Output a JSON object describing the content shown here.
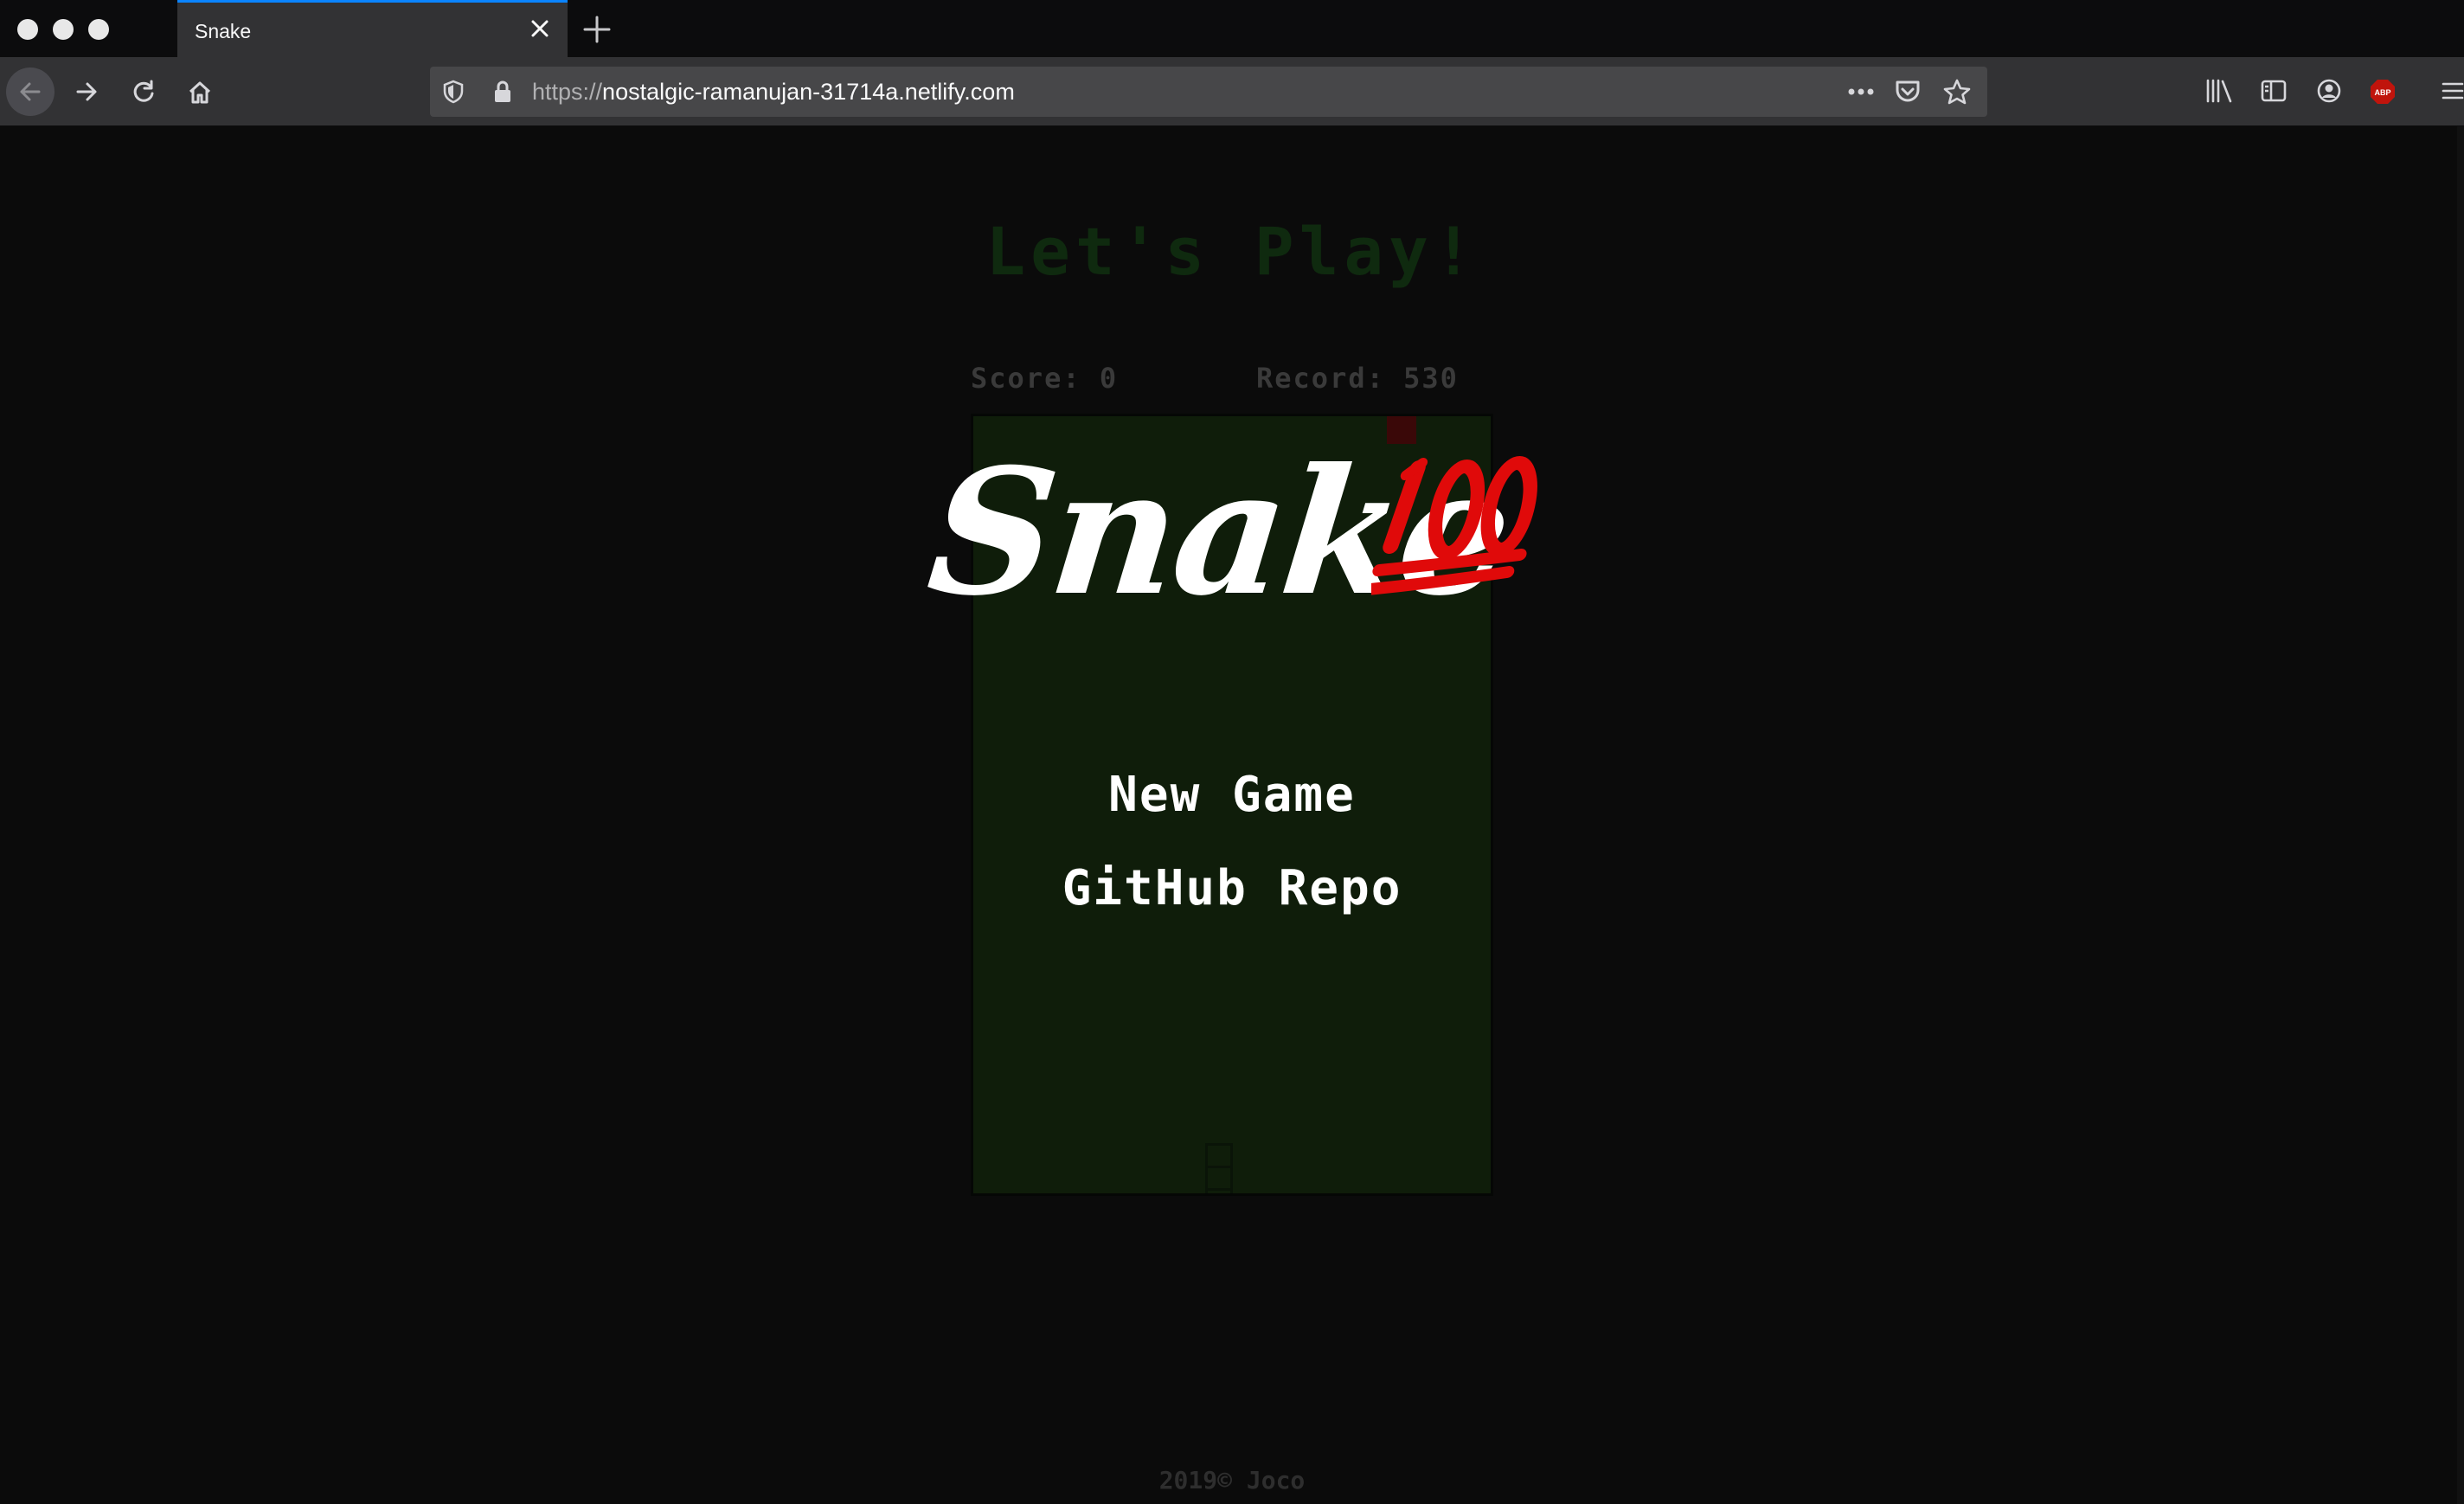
{
  "browser": {
    "tab": {
      "title": "Snake"
    },
    "url": {
      "scheme": "https://",
      "host": "nostalgic-ramanujan-31714a.netlify.com"
    },
    "toolbar_icons": [
      "library-icon",
      "sidebar-icon",
      "account-icon",
      "adblock-icon",
      "menu-icon"
    ],
    "adblock_badge": "ABP"
  },
  "page": {
    "heading": "Let's Play!",
    "score_label": "Score: 0",
    "record_label": "Record: 530",
    "logo_text": "Snake",
    "logo_emoji": "100",
    "menu": {
      "new_game": "New Game",
      "github_repo": "GitHub Repo"
    },
    "footer": "2019© Joco"
  },
  "colors": {
    "background": "#0b0b0b",
    "board": "#0f1d0a",
    "heading": "#0f2a0f",
    "food": "#3a0808",
    "emoji_red": "#e00a0a",
    "accent_tab": "#0a84ff"
  }
}
